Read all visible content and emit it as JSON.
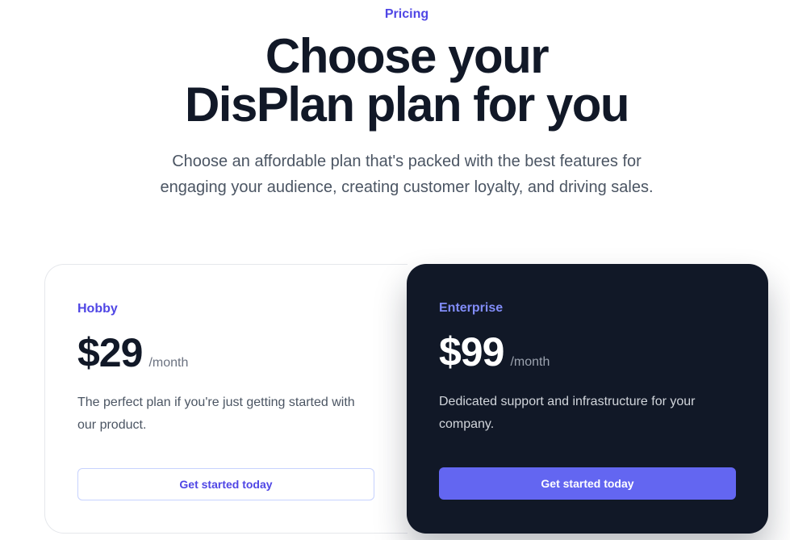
{
  "header": {
    "eyebrow": "Pricing",
    "title_line1": "Choose your",
    "title_line2": "DisPlan plan for you",
    "subtitle_line1": "Choose an affordable plan that's packed with the best features for",
    "subtitle_line2": "engaging your audience, creating customer loyalty, and driving sales."
  },
  "plans": [
    {
      "name": "Hobby",
      "price": "$29",
      "period": "/month",
      "description": "The perfect plan if you're just getting started with our product.",
      "cta_label": "Get started today"
    },
    {
      "name": "Enterprise",
      "price": "$99",
      "period": "/month",
      "description": "Dedicated support and infrastructure for your company.",
      "cta_label": "Get started today"
    }
  ],
  "colors": {
    "accent": "#4f46e5",
    "button_primary": "#6366f1",
    "dark_card": "#111827",
    "heading": "#111827",
    "body_text": "#4b5563"
  }
}
